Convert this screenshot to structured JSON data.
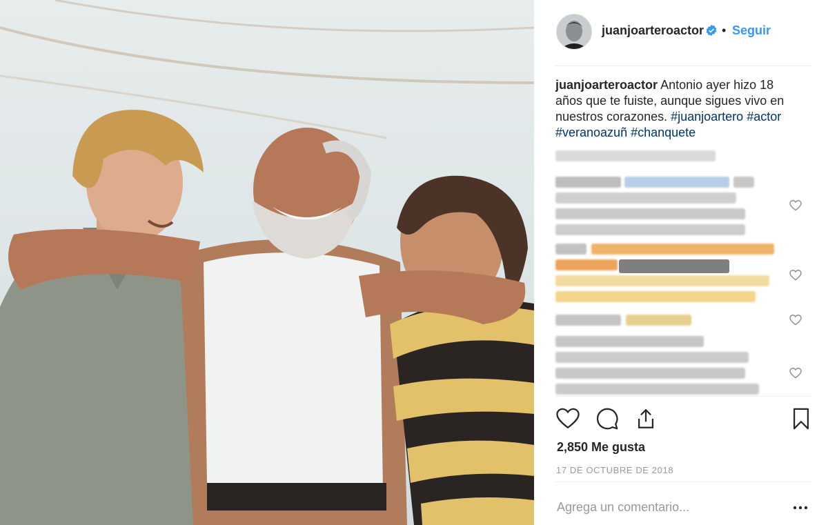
{
  "post": {
    "username": "juanjoarteroactor",
    "separator": "•",
    "follow_label": "Seguir",
    "caption": {
      "username": "juanjoarteroactor",
      "text": "Antonio ayer hizo 18 años que te fuiste, aunque sigues vivo en nuestros corazones.",
      "hashtags": [
        "#juanjoartero",
        "#actor",
        "#veranoazuñ",
        "#chanquete"
      ]
    },
    "likes_text": "2,850 Me gusta",
    "date_text": "17 DE OCTUBRE DE 2018",
    "comment_placeholder": "Agrega un comentario..."
  },
  "icons": {
    "verified": "verified-badge-icon",
    "like": "heart-icon",
    "comment": "speech-bubble-icon",
    "share": "share-icon",
    "save": "bookmark-icon",
    "more": "ellipsis-icon"
  },
  "colors": {
    "link_blue": "#3897f0",
    "hashtag": "#003569",
    "muted": "#999999"
  }
}
